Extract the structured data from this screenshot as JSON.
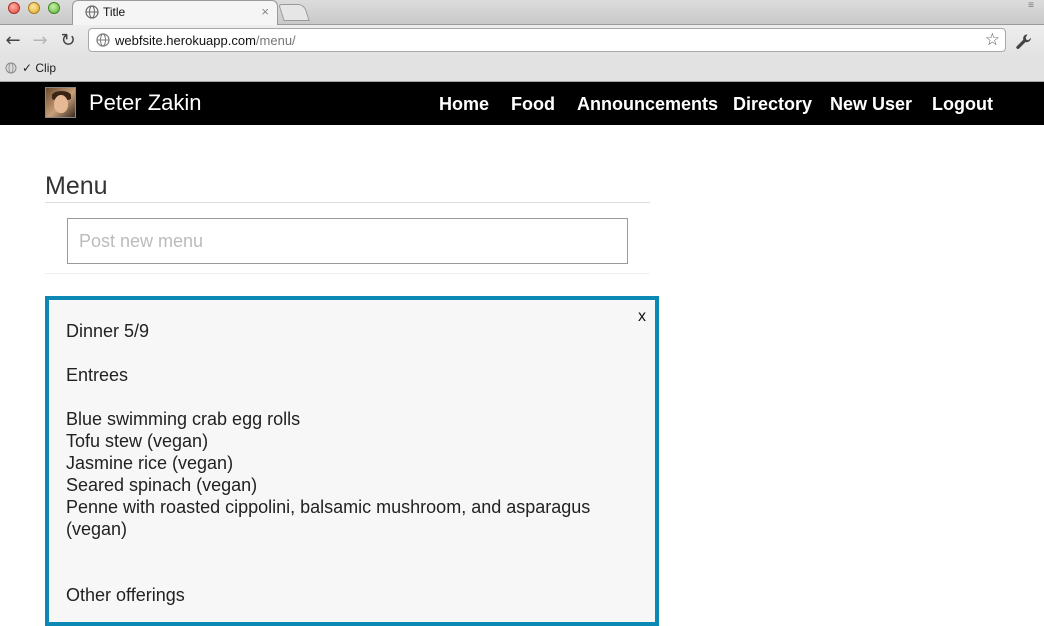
{
  "browser": {
    "tab_title": "Title",
    "tab_close": "×",
    "url_host": "webfsite.herokuapp.com",
    "url_path": "/menu/",
    "bookmark_label": "✓ Clip"
  },
  "navbar": {
    "brand": "Peter Zakin",
    "links": [
      "Home",
      "Food",
      "Announcements",
      "Directory",
      "New User",
      "Logout"
    ]
  },
  "page": {
    "title": "Menu",
    "post_placeholder": "Post new menu"
  },
  "menu_card": {
    "close_label": "x",
    "lines": [
      "Dinner 5/9",
      "",
      "Entrees",
      "",
      "Blue swimming crab egg rolls",
      "Tofu stew (vegan)",
      "Jasmine rice (vegan)",
      "Seared spinach (vegan)",
      "Penne with roasted cippolini, balsamic mushroom, and asparagus (vegan)",
      "",
      "",
      "Other offerings"
    ]
  },
  "colors": {
    "navbar_bg": "#000000",
    "card_border": "#0c88b4"
  }
}
